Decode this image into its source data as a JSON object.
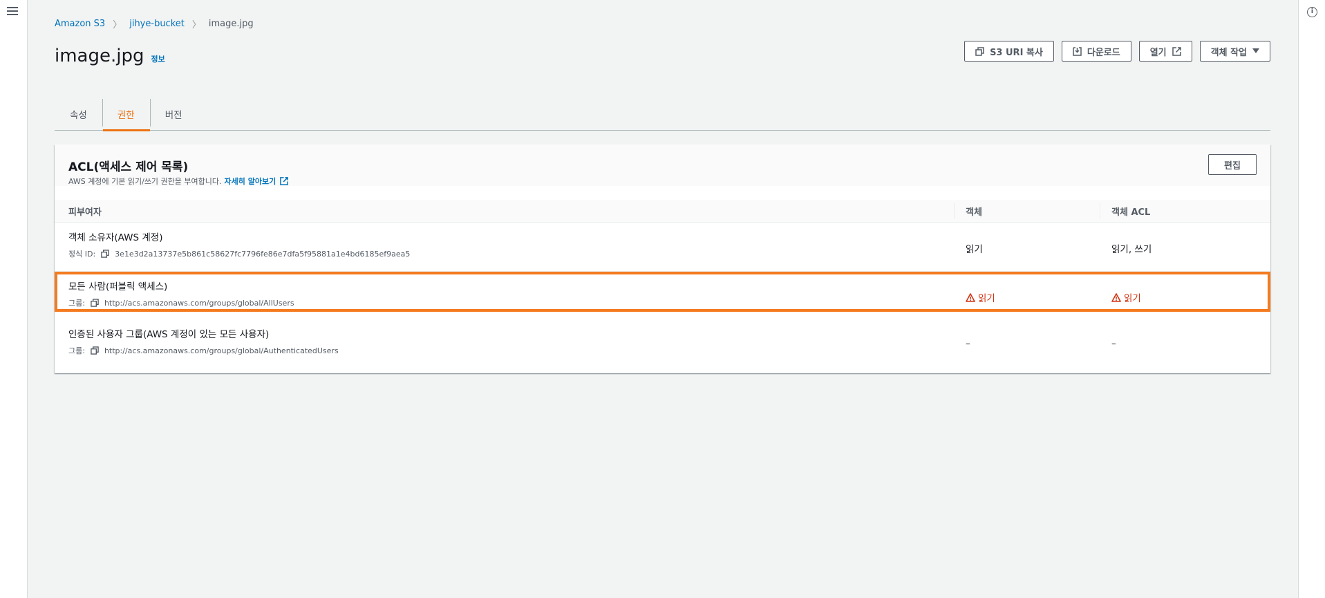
{
  "breadcrumb": {
    "items": [
      "Amazon S3",
      "jihye-bucket"
    ],
    "current": "image.jpg"
  },
  "header": {
    "title": "image.jpg",
    "info_link": "정보",
    "buttons": {
      "copy_uri": "S3 URI 복사",
      "download": "다운로드",
      "open": "열기",
      "object_actions": "객체 작업"
    }
  },
  "tabs": [
    {
      "label": "속성",
      "active": false
    },
    {
      "label": "권한",
      "active": true
    },
    {
      "label": "버전",
      "active": false
    }
  ],
  "acl": {
    "title": "ACL(액세스 제어 목록)",
    "description": "AWS 계정에 기본 읽기/쓰기 권한을 부여합니다.",
    "learn_more": "자세히 알아보기",
    "edit_label": "편집",
    "columns": [
      "피부여자",
      "객체",
      "객체 ACL"
    ],
    "rows": [
      {
        "grantee": "객체 소유자(AWS 계정)",
        "sub_label": "정식 ID:",
        "sub_value": "3e1e3d2a13737e5b861c58627fc7796fe86e7dfa5f95881a1e4bd6185ef9aea5",
        "object": "읽기",
        "object_acl": "읽기, 쓰기"
      },
      {
        "grantee": "모든 사람(퍼블릭 액세스)",
        "sub_label": "그룹:",
        "sub_value": "http://acs.amazonaws.com/groups/global/AllUsers",
        "object": "읽기",
        "object_acl": "읽기"
      },
      {
        "grantee": "인증된 사용자 그룹(AWS 계정이 있는 모든 사용자)",
        "sub_label": "그룹:",
        "sub_value": "http://acs.amazonaws.com/groups/global/AuthenticatedUsers",
        "object": "–",
        "object_acl": "–"
      }
    ]
  },
  "colors": {
    "accent": "#ec7211",
    "link": "#0073bb",
    "warning": "#d13212",
    "highlight_border": "#f47b20"
  }
}
